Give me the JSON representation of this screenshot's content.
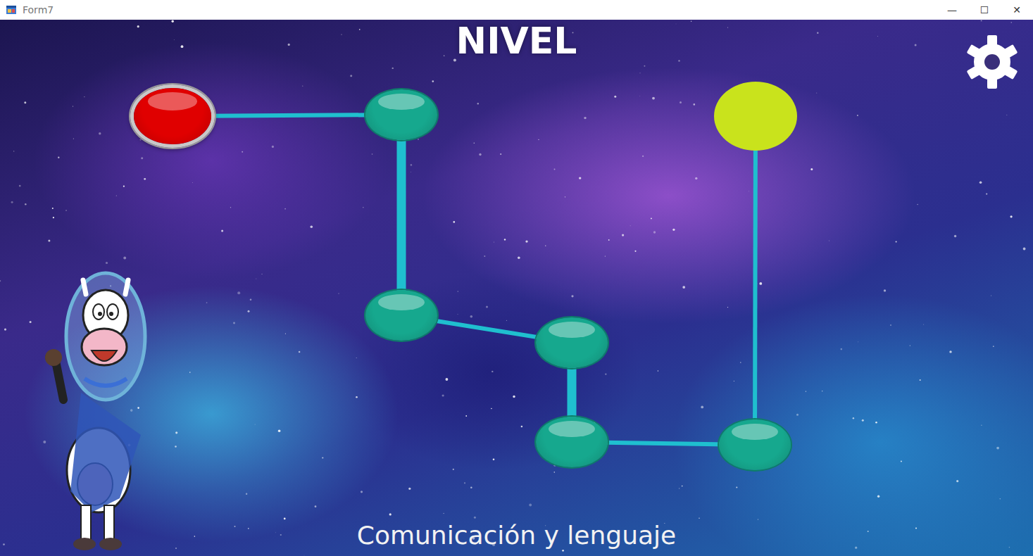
{
  "window": {
    "title": "Form7",
    "controls": [
      "—",
      "☐",
      "✕"
    ]
  },
  "header": {
    "title": "NIVEL"
  },
  "path": {
    "nodes": [
      {
        "kind": "current",
        "color": "#e00000"
      },
      {
        "kind": "level",
        "color": "#16a88e"
      },
      {
        "kind": "level",
        "color": "#16a88e"
      },
      {
        "kind": "level",
        "color": "#16a88e"
      },
      {
        "kind": "level",
        "color": "#16a88e"
      },
      {
        "kind": "level",
        "color": "#16a88e"
      },
      {
        "kind": "goal",
        "color": "#c9e31c"
      }
    ]
  },
  "footer": {
    "subject": "Comunicación y lenguaje"
  }
}
